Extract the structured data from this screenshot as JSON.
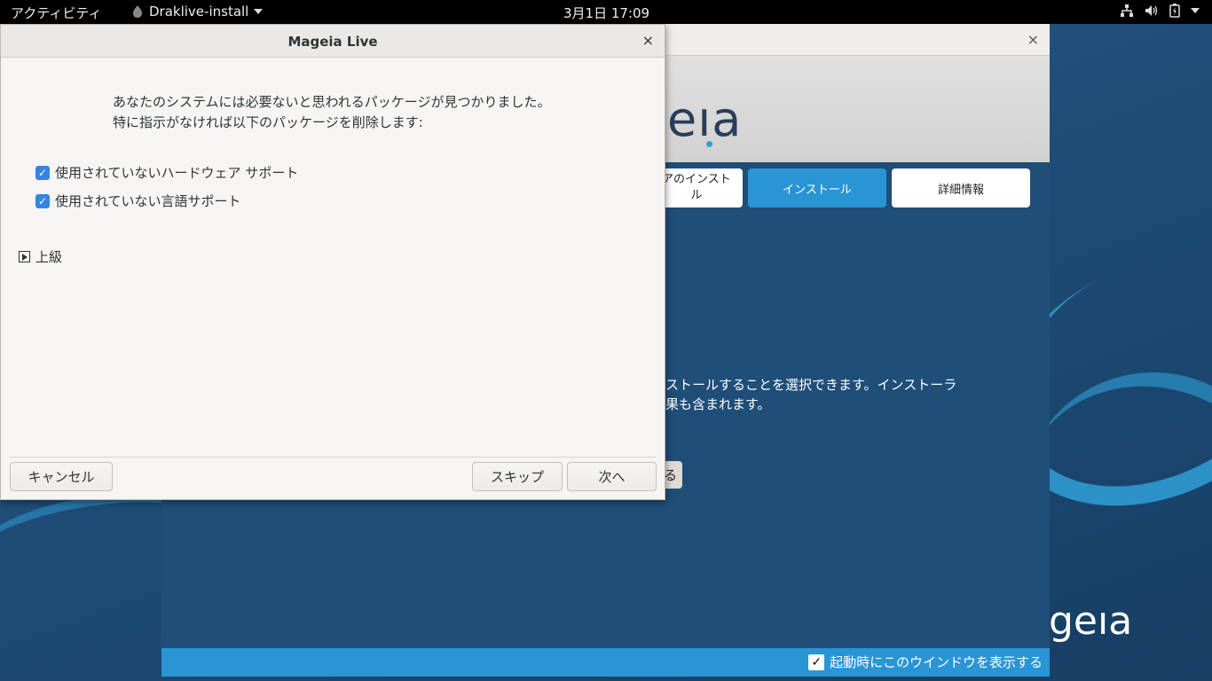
{
  "topbar": {
    "activities": "アクティビティ",
    "app_name": "Draklive-install",
    "clock": "3月1日  17:09",
    "icons": [
      "network-icon",
      "volume-icon",
      "battery-icon",
      "power-menu-icon"
    ]
  },
  "background_window": {
    "logo_text": "eıa",
    "buttons": [
      "アのインスト\nル",
      "インストール",
      "詳細情報"
    ],
    "description": "ストールすることを選択できます。インストーラ\n果も含まれます。",
    "partial_button": "る",
    "bottom_logo": "geıa",
    "startup_checkbox": {
      "label": "起動時にこのウインドウを表示する",
      "checked": true,
      "mark": "✓"
    },
    "close_glyph": "×"
  },
  "dialog": {
    "title": "Mageia Live",
    "close_glyph": "×",
    "message_line1": "あなたのシステムには必要ないと思われるパッケージが見つかりました。",
    "message_line2": "特に指示がなければ以下のパッケージを削除します:",
    "options": [
      {
        "label": "使用されていないハードウェア サポート",
        "checked": true
      },
      {
        "label": "使用されていない言語サポート",
        "checked": true
      }
    ],
    "check_mark": "✓",
    "advanced_label": "上級",
    "buttons": {
      "cancel": "キャンセル",
      "skip": "スキップ",
      "next": "次へ"
    }
  },
  "colors": {
    "accent": "#2a95d5",
    "checkbox": "#3584e4",
    "desktop": "#1f4e78"
  }
}
